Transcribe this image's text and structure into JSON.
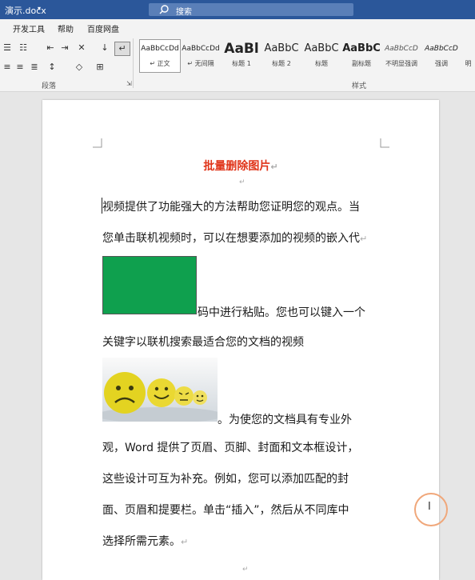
{
  "titlebar": {
    "filename": "演示.docx",
    "search_placeholder": "搜索"
  },
  "menu": {
    "items": [
      "开发工具",
      "帮助",
      "百度网盘"
    ]
  },
  "ribbon": {
    "paragraph_group_label": "段落",
    "styles_group_label": "样式",
    "styles": [
      {
        "preview": "AaBbCcDd",
        "name": "↵ 正文"
      },
      {
        "preview": "AaBbCcDd",
        "name": "↵ 无间隔"
      },
      {
        "preview": "AaBl",
        "name": "标题 1"
      },
      {
        "preview": "AaBbC",
        "name": "标题 2"
      },
      {
        "preview": "AaBbC",
        "name": "标题"
      },
      {
        "preview": "AaBbC",
        "name": "副标题"
      },
      {
        "preview": "AaBbCcD",
        "name": "不明显强调"
      },
      {
        "preview": "AaBbCcD",
        "name": "强调"
      },
      {
        "preview": "",
        "name": "明"
      }
    ]
  },
  "document": {
    "heading": "批量删除图片",
    "lines": [
      "视频提供了功能强大的方法帮助您证明您的观点。当",
      "您单击联机视频时，可以在想要添加的视频的嵌入代",
      "码中进行粘贴。您也可以键入一个",
      "关键字以联机搜索最适合您的文档的视频",
      "。为使您的文档具有专业外",
      "观，Word 提供了页眉、页脚、封面和文本框设计，",
      "这些设计可互为补充。例如，您可以添加匹配的封",
      "面、页眉和提要栏。单击“插入”，然后从不同库中",
      "选择所需元素。"
    ],
    "paragraph_mark": "↵"
  },
  "colors": {
    "title_bar": "#2b579a",
    "heading": "#e0351a",
    "shape_green": "#0fa04e",
    "cursor_ring": "#f0a77a"
  }
}
